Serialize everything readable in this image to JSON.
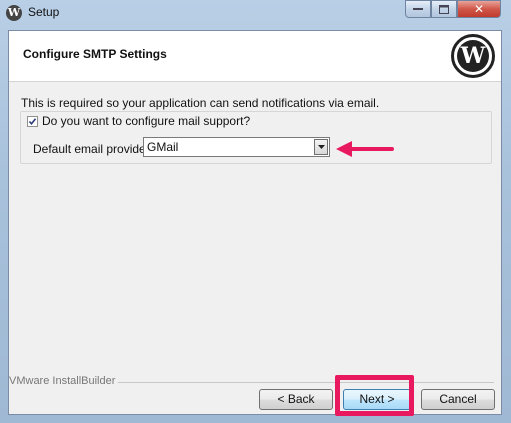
{
  "window": {
    "title": "Setup"
  },
  "header": {
    "title": "Configure SMTP Settings"
  },
  "main": {
    "description": "This is required so your application can send notifications via email.",
    "mail_support_label": "Do you want to configure mail support?",
    "mail_support_checked": true,
    "provider_label": "Default email provider:",
    "provider_value": "GMail"
  },
  "footer": {
    "brand": "VMware InstallBuilder",
    "back_label": "< Back",
    "next_label": "Next >",
    "cancel_label": "Cancel"
  },
  "annotations": {
    "arrow_color": "#e8195f",
    "highlight_color": "#e8195f"
  },
  "icons": {
    "app": "wordpress-icon",
    "logo": "wordpress-logo",
    "combo": "chevron-down-icon"
  }
}
